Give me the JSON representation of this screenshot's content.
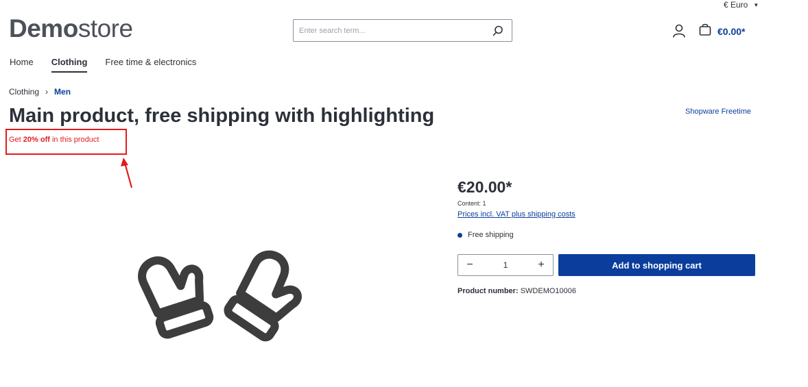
{
  "header": {
    "currency": "€ Euro",
    "logo_bold": "Demo",
    "logo_light": "store",
    "search_placeholder": "Enter search term...",
    "cart_total": "€0.00*"
  },
  "nav": {
    "items": [
      "Home",
      "Clothing",
      "Free time & electronics"
    ]
  },
  "breadcrumb": {
    "parent": "Clothing",
    "current": "Men"
  },
  "product": {
    "title": "Main product, free shipping with highlighting",
    "manufacturer": "Shopware Freetime",
    "promo_prefix": "Get ",
    "promo_bold": "20% off",
    "promo_suffix": " in this product",
    "price": "€20.00*",
    "content": "Content: 1",
    "price_note": "Prices incl. VAT plus shipping costs",
    "shipping": "Free shipping",
    "quantity": "1",
    "add_to_cart": "Add to shopping cart",
    "product_number_label": "Product number:",
    "product_number": "SWDEMO10006"
  },
  "colors": {
    "accent": "#0b3e9c",
    "highlight": "#e21b1b"
  }
}
